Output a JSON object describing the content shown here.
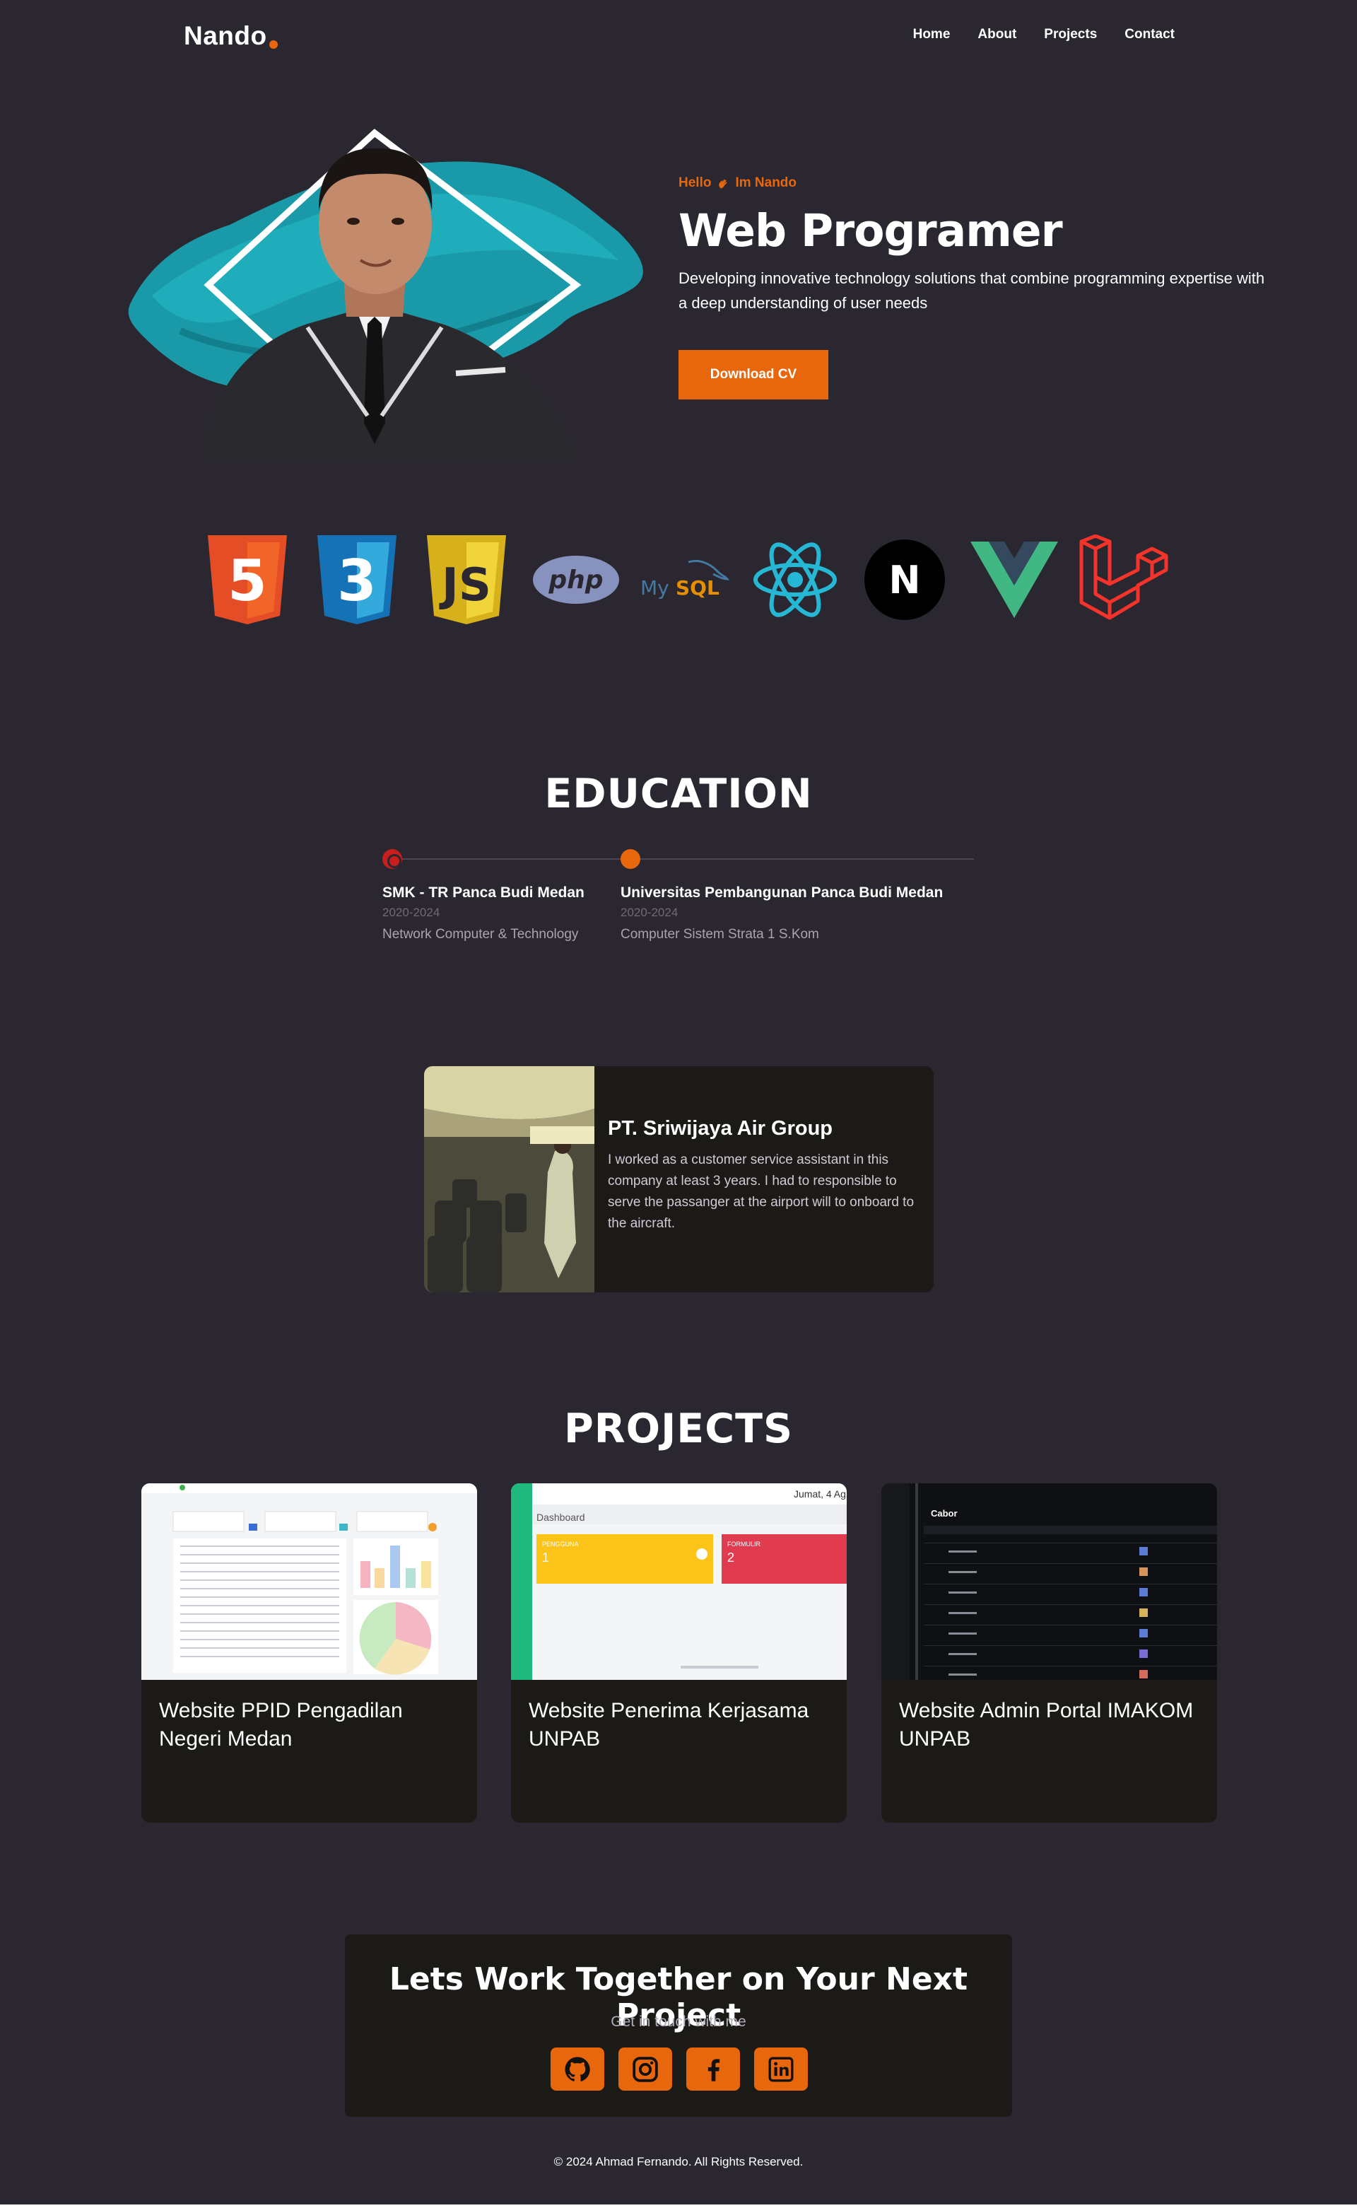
{
  "nav": {
    "brand": "Nando",
    "links": [
      "Home",
      "About",
      "Projects",
      "Contact"
    ]
  },
  "hero": {
    "greeting": "Hello",
    "greeting_name": "Im Nando",
    "title": "Web Programer",
    "description": "Developing innovative technology solutions that combine programming expertise with a deep understanding of user needs",
    "cta": "Download CV",
    "accent": "#e8670c"
  },
  "tech_stack": [
    "html5-icon",
    "css3-icon",
    "javascript-icon",
    "php-icon",
    "mysql-icon",
    "react-icon",
    "nextjs-icon",
    "vue-icon",
    "laravel-icon"
  ],
  "tech_text": {
    "html": "5",
    "css": "3",
    "js": "JS",
    "php": "php",
    "mysql_a": "My",
    "mysql_b": "SQL",
    "next": "N"
  },
  "education": {
    "title": "EDUCATION",
    "items": [
      {
        "name": "SMK - TR Panca Budi Medan",
        "year": "2020-2024",
        "major": "Network Computer & Technology"
      },
      {
        "name": "Universitas Pembangunan Panca Budi Medan",
        "year": "2020-2024",
        "major": "Computer Sistem Strata 1 S.Kom"
      }
    ]
  },
  "experience": {
    "company": "PT. Sriwijaya Air Group",
    "description": "I worked as a customer service assistant in this company at least 3 years. I had to responsible to serve the passanger at the airport will to onboard to the aircraft."
  },
  "projects": {
    "title": "PROJECTS",
    "items": [
      {
        "title": "Website PPID Pengadilan Negeri Medan"
      },
      {
        "title": "Website Penerima Kerjasama UNPAB",
        "shot_date": "Jumat, 4 Ag",
        "shot_heading": "Dashboard",
        "card_a_label": "PENGGUNA",
        "card_a_value": "1",
        "card_b_label": "FORMULIR",
        "card_b_value": "2"
      },
      {
        "title": "Website Admin Portal IMAKOM UNPAB",
        "shot_heading": "Cabor"
      }
    ]
  },
  "contact": {
    "title": "Lets Work Together on Your Next Project",
    "subtitle": "Get in touch with me",
    "socials": [
      "github-icon",
      "instagram-icon",
      "facebook-icon",
      "linkedin-icon"
    ]
  },
  "footer": {
    "copyright": "© 2024 Ahmad Fernando. All Rights Reserved."
  }
}
